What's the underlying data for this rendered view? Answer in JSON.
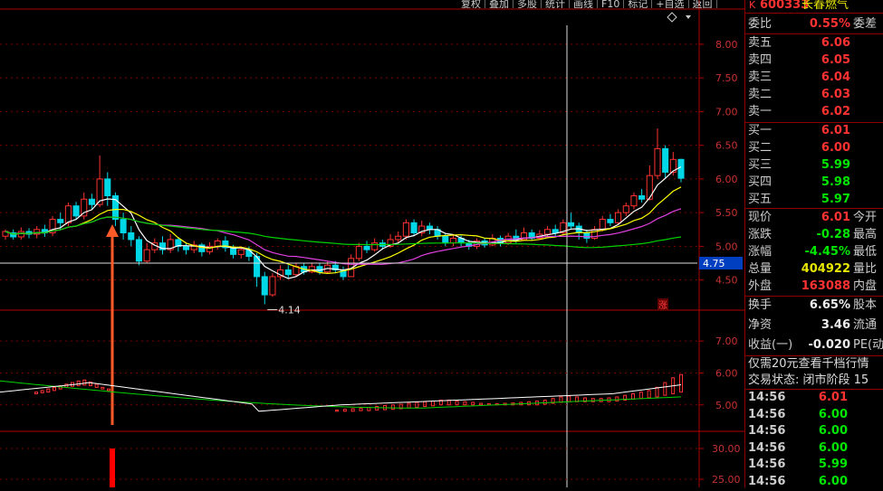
{
  "toolbar": [
    "复权",
    "叠加",
    "多股",
    "统计",
    "画线",
    "F10",
    "标记",
    "+自选",
    "返回"
  ],
  "header": {
    "code_prefix": "K",
    "code": "600333",
    "name": "长春燃气"
  },
  "panel": {
    "weibi": {
      "label": "委比",
      "value": "0.55%",
      "ext": "委差"
    },
    "sell": [
      {
        "label": "卖五",
        "price": "6.06"
      },
      {
        "label": "卖四",
        "price": "6.05"
      },
      {
        "label": "卖三",
        "price": "6.04"
      },
      {
        "label": "卖二",
        "price": "6.03"
      },
      {
        "label": "卖一",
        "price": "6.02"
      }
    ],
    "buy": [
      {
        "label": "买一",
        "price": "6.01"
      },
      {
        "label": "买二",
        "price": "6.00"
      },
      {
        "label": "买三",
        "price": "5.99"
      },
      {
        "label": "买四",
        "price": "5.98"
      },
      {
        "label": "买五",
        "price": "5.97"
      }
    ],
    "stats": [
      {
        "label": "现价",
        "value": "6.01",
        "ext": "今开",
        "color": "red"
      },
      {
        "label": "涨跌",
        "value": "-0.28",
        "ext": "最高",
        "color": "grn"
      },
      {
        "label": "涨幅",
        "value": "-4.45%",
        "ext": "最低",
        "color": "grn"
      },
      {
        "label": "总量",
        "value": "404922",
        "ext": "量比",
        "color": "yel"
      },
      {
        "label": "外盘",
        "value": "163088",
        "ext": "内盘",
        "color": "red"
      }
    ],
    "stats2": [
      {
        "label": "换手",
        "value": "6.65%",
        "ext": "股本",
        "color": "wht"
      },
      {
        "label": "净资",
        "value": "3.46",
        "ext": "流通",
        "color": "wht"
      },
      {
        "label": "收益(一)",
        "value": "-0.020",
        "ext": "PE(动",
        "color": "wht"
      }
    ],
    "promo": "仅需20元查看千档行情",
    "trade_state": "交易状态: 闭市阶段 15",
    "ticks": [
      {
        "time": "14:56",
        "price": "6.01",
        "color": "red"
      },
      {
        "time": "14:56",
        "price": "6.00",
        "color": "grn"
      },
      {
        "time": "14:56",
        "price": "6.00",
        "color": "grn"
      },
      {
        "time": "14:56",
        "price": "6.00",
        "color": "grn"
      },
      {
        "time": "14:56",
        "price": "5.99",
        "color": "grn"
      },
      {
        "time": "14:56",
        "price": "6.00",
        "color": "grn"
      }
    ]
  },
  "chart_data": [
    {
      "type": "candlestick",
      "ylim": [
        4.2,
        8.2
      ],
      "yticks": [
        "8.00",
        "7.50",
        "7.00",
        "6.50",
        "6.00",
        "5.50",
        "5.00",
        "4.50"
      ],
      "crosshair_price": "4.75",
      "low_annotation": "4.14",
      "badge": "涨",
      "colors": {
        "up": "#ff3232",
        "down": "#00d7e6",
        "ma5": "#ffffff",
        "ma10": "#ffff00",
        "ma20": "#e040e0",
        "ma60": "#00d200"
      },
      "candles": [
        [
          5.15,
          5.22,
          5.1,
          5.25
        ],
        [
          5.2,
          5.14,
          5.1,
          5.25
        ],
        [
          5.14,
          5.22,
          5.1,
          5.28
        ],
        [
          5.22,
          5.18,
          5.12,
          5.27
        ],
        [
          5.18,
          5.25,
          5.12,
          5.3
        ],
        [
          5.25,
          5.2,
          5.14,
          5.32
        ],
        [
          5.2,
          5.4,
          5.15,
          5.45
        ],
        [
          5.4,
          5.35,
          5.25,
          5.5
        ],
        [
          5.35,
          5.6,
          5.3,
          5.65
        ],
        [
          5.6,
          5.45,
          5.4,
          5.66
        ],
        [
          5.45,
          5.7,
          5.4,
          5.8
        ],
        [
          5.7,
          5.62,
          5.55,
          5.78
        ],
        [
          5.62,
          6.0,
          5.58,
          6.35
        ],
        [
          6.0,
          5.75,
          5.6,
          6.1
        ],
        [
          5.75,
          5.4,
          5.3,
          5.8
        ],
        [
          5.4,
          5.2,
          5.1,
          5.5
        ],
        [
          5.2,
          5.1,
          5.0,
          5.3
        ],
        [
          5.1,
          4.78,
          4.72,
          5.15
        ],
        [
          4.78,
          4.95,
          4.75,
          5.05
        ],
        [
          4.95,
          5.05,
          4.9,
          5.12
        ],
        [
          5.05,
          4.95,
          4.88,
          5.15
        ],
        [
          4.95,
          5.1,
          4.9,
          5.18
        ],
        [
          5.1,
          5.0,
          4.92,
          5.14
        ],
        [
          5.0,
          4.95,
          4.88,
          5.05
        ],
        [
          4.95,
          5.02,
          4.9,
          5.08
        ],
        [
          5.02,
          4.92,
          4.85,
          5.05
        ],
        [
          4.92,
          5.0,
          4.88,
          5.06
        ],
        [
          5.0,
          5.08,
          4.95,
          5.12
        ],
        [
          5.08,
          4.98,
          4.92,
          5.15
        ],
        [
          4.98,
          4.88,
          4.82,
          5.02
        ],
        [
          4.88,
          4.95,
          4.82,
          5.0
        ],
        [
          4.95,
          4.85,
          4.78,
          5.0
        ],
        [
          4.85,
          4.55,
          4.4,
          4.9
        ],
        [
          4.55,
          4.28,
          4.14,
          4.62
        ],
        [
          4.28,
          4.55,
          4.25,
          4.6
        ],
        [
          4.55,
          4.65,
          4.5,
          4.72
        ],
        [
          4.65,
          4.58,
          4.52,
          4.72
        ],
        [
          4.58,
          4.7,
          4.55,
          4.75
        ],
        [
          4.7,
          4.62,
          4.58,
          4.75
        ],
        [
          4.62,
          4.7,
          4.6,
          4.76
        ],
        [
          4.7,
          4.62,
          4.58,
          4.75
        ],
        [
          4.62,
          4.72,
          4.6,
          4.78
        ],
        [
          4.72,
          4.65,
          4.6,
          4.78
        ],
        [
          4.65,
          4.55,
          4.5,
          4.7
        ],
        [
          4.55,
          4.82,
          4.55,
          4.88
        ],
        [
          4.82,
          5.0,
          4.78,
          5.05
        ],
        [
          5.0,
          4.95,
          4.9,
          5.08
        ],
        [
          4.95,
          5.05,
          4.92,
          5.12
        ],
        [
          5.05,
          5.0,
          4.95,
          5.1
        ],
        [
          5.0,
          5.1,
          4.98,
          5.18
        ],
        [
          5.1,
          5.15,
          5.05,
          5.22
        ],
        [
          5.15,
          5.35,
          5.1,
          5.4
        ],
        [
          5.35,
          5.2,
          5.15,
          5.4
        ],
        [
          5.2,
          5.3,
          5.15,
          5.38
        ],
        [
          5.3,
          5.25,
          5.18,
          5.35
        ],
        [
          5.25,
          5.15,
          5.1,
          5.3
        ],
        [
          5.15,
          5.05,
          5.0,
          5.2
        ],
        [
          5.05,
          5.12,
          5.0,
          5.18
        ],
        [
          5.12,
          5.05,
          5.0,
          5.16
        ],
        [
          5.05,
          5.0,
          4.95,
          5.1
        ],
        [
          5.0,
          5.08,
          4.96,
          5.12
        ],
        [
          5.08,
          5.02,
          4.98,
          5.12
        ],
        [
          5.02,
          5.12,
          5.0,
          5.18
        ],
        [
          5.12,
          5.05,
          5.0,
          5.16
        ],
        [
          5.05,
          5.15,
          5.02,
          5.2
        ],
        [
          5.15,
          5.1,
          5.05,
          5.25
        ],
        [
          5.1,
          5.2,
          5.08,
          5.28
        ],
        [
          5.2,
          5.12,
          5.08,
          5.25
        ],
        [
          5.12,
          5.18,
          5.1,
          5.24
        ],
        [
          5.18,
          5.25,
          5.12,
          5.3
        ],
        [
          5.25,
          5.2,
          5.15,
          5.32
        ],
        [
          5.2,
          5.35,
          5.18,
          5.4
        ],
        [
          5.35,
          5.3,
          5.25,
          5.5
        ],
        [
          5.3,
          5.2,
          5.1,
          5.35
        ],
        [
          5.2,
          5.12,
          5.05,
          5.25
        ],
        [
          5.12,
          5.25,
          5.1,
          5.3
        ],
        [
          5.25,
          5.4,
          5.22,
          5.45
        ],
        [
          5.4,
          5.35,
          5.3,
          5.48
        ],
        [
          5.35,
          5.5,
          5.32,
          5.55
        ],
        [
          5.5,
          5.6,
          5.45,
          5.65
        ],
        [
          5.6,
          5.75,
          5.55,
          5.8
        ],
        [
          5.75,
          5.7,
          5.65,
          5.85
        ],
        [
          5.7,
          6.05,
          5.68,
          6.2
        ],
        [
          6.05,
          6.45,
          6.0,
          6.75
        ],
        [
          6.45,
          6.1,
          6.0,
          6.5
        ],
        [
          6.1,
          6.29,
          6.05,
          6.4
        ],
        [
          6.29,
          6.01,
          5.95,
          6.3
        ]
      ]
    },
    {
      "type": "indicator",
      "ylim": [
        4.2,
        7.6
      ],
      "yticks": [
        "7.00",
        "6.00",
        "5.00"
      ],
      "colors": {
        "bars": "#ff3232",
        "line_white": "#ffffff",
        "line_green": "#00d200"
      },
      "bars": [
        [
          5.35,
          5.4
        ],
        [
          5.38,
          5.45
        ],
        [
          5.4,
          5.5
        ],
        [
          5.45,
          5.55
        ],
        [
          5.5,
          5.6
        ],
        [
          5.55,
          5.65
        ],
        [
          5.58,
          5.7
        ],
        [
          5.6,
          5.75
        ],
        [
          5.62,
          5.78
        ],
        [
          5.6,
          5.72
        ],
        [
          5.55,
          5.65
        ],
        [
          5.5,
          5.55
        ],
        [
          5.45,
          5.5
        ]
      ],
      "bars2": [
        [
          4.8,
          4.84
        ],
        [
          4.8,
          4.86
        ],
        [
          4.8,
          4.88
        ],
        [
          4.82,
          4.9
        ],
        [
          4.82,
          4.92
        ],
        [
          4.84,
          4.95
        ],
        [
          4.85,
          4.98
        ],
        [
          4.86,
          5.0
        ],
        [
          4.88,
          5.02
        ],
        [
          4.9,
          5.05
        ],
        [
          4.92,
          5.08
        ],
        [
          4.95,
          5.1
        ],
        [
          4.97,
          5.12
        ],
        [
          5.0,
          5.15
        ],
        [
          5.0,
          5.15
        ],
        [
          5.0,
          5.12
        ],
        [
          5.0,
          5.1
        ],
        [
          5.0,
          5.08
        ],
        [
          5.0,
          5.05
        ],
        [
          5.0,
          5.04
        ],
        [
          5.0,
          5.04
        ],
        [
          5.0,
          5.05
        ],
        [
          5.0,
          5.06
        ],
        [
          5.0,
          5.08
        ],
        [
          5.0,
          5.1
        ],
        [
          5.0,
          5.12
        ],
        [
          5.02,
          5.15
        ],
        [
          5.05,
          5.2
        ],
        [
          5.08,
          5.25
        ],
        [
          5.1,
          5.28
        ],
        [
          5.1,
          5.25
        ],
        [
          5.1,
          5.22
        ],
        [
          5.1,
          5.2
        ],
        [
          5.1,
          5.2
        ],
        [
          5.1,
          5.22
        ],
        [
          5.12,
          5.25
        ],
        [
          5.15,
          5.3
        ],
        [
          5.18,
          5.35
        ],
        [
          5.2,
          5.4
        ],
        [
          5.22,
          5.45
        ],
        [
          5.25,
          5.55
        ],
        [
          5.3,
          5.7
        ],
        [
          5.35,
          5.85
        ],
        [
          5.4,
          5.95
        ]
      ]
    },
    {
      "type": "volume",
      "yticks": [
        "30.00",
        "25.00"
      ],
      "colors": {
        "bar": "#ff0000"
      }
    }
  ]
}
